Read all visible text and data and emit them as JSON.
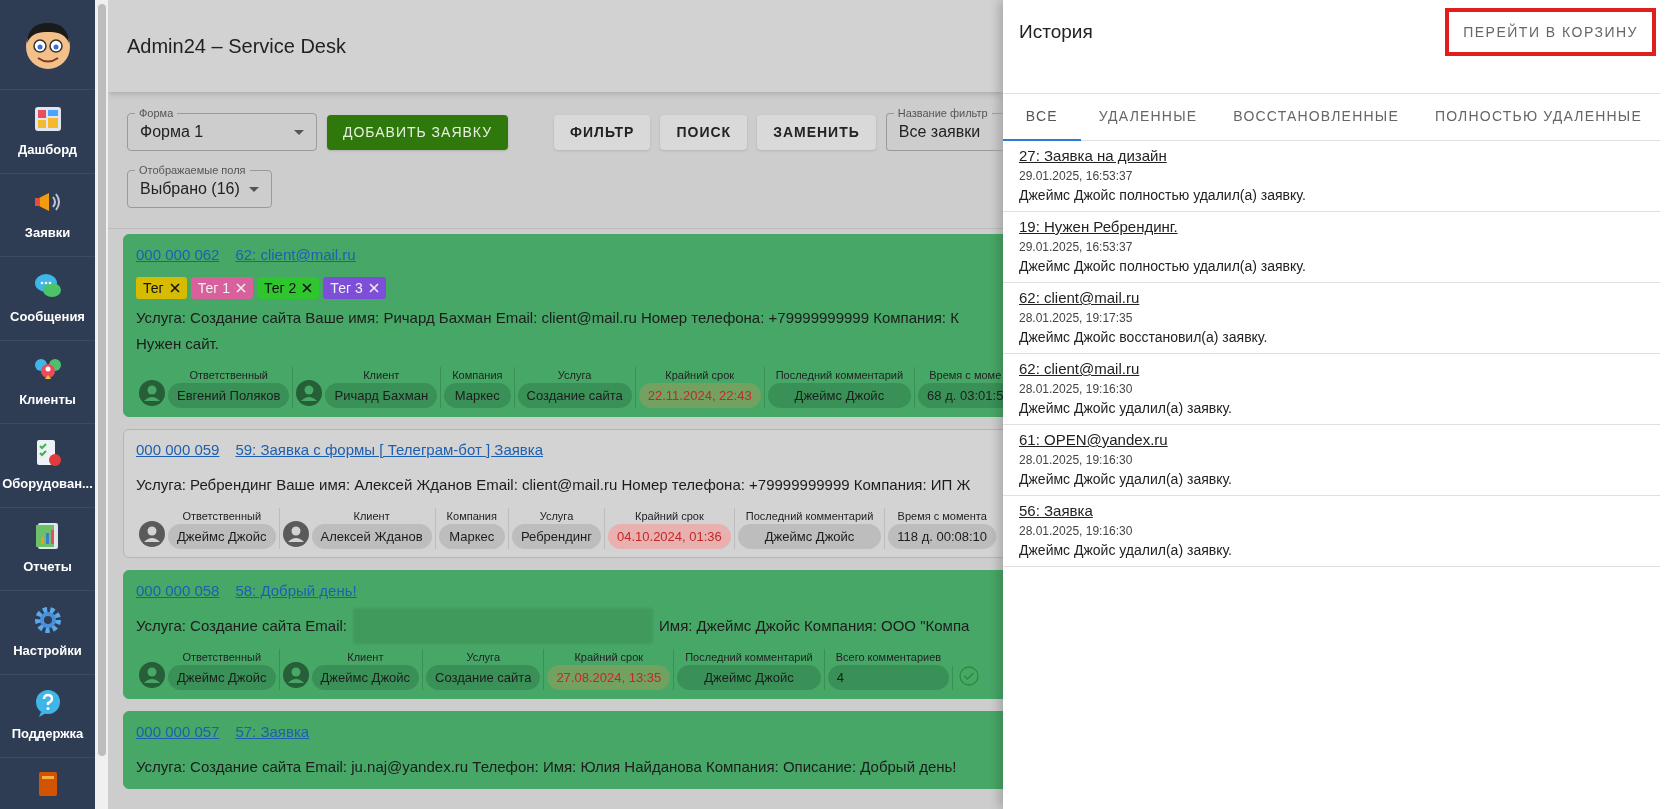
{
  "sidebar": {
    "items": [
      {
        "label": "Дашборд"
      },
      {
        "label": "Заявки"
      },
      {
        "label": "Сообщения"
      },
      {
        "label": "Клиенты"
      },
      {
        "label": "Оборудован..."
      },
      {
        "label": "Отчеты"
      },
      {
        "label": "Настройки"
      },
      {
        "label": "Поддержка"
      }
    ]
  },
  "header": {
    "title": "Admin24 – Service Desk"
  },
  "toolbar": {
    "form_select": {
      "label": "Форма",
      "value": "Форма 1"
    },
    "add_button": "ДОБАВИТЬ ЗАЯВКУ",
    "buttons": [
      "ФИЛЬТР",
      "ПОИСК",
      "ЗАМЕНИТЬ"
    ],
    "filter_select": {
      "label": "Название фильтр",
      "value": "Все заявки"
    },
    "fields_select": {
      "label": "Отображаемые поля",
      "value": "Выбрано (16)"
    }
  },
  "tickets": [
    {
      "number": "000 000 062",
      "title": "62: client@mail.ru",
      "highlighted": true,
      "checked": false,
      "tags": [
        {
          "label": "Тег",
          "color": "#d6bb00"
        },
        {
          "label": "Тег 1",
          "color": "#d8609c"
        },
        {
          "label": "Тег 2",
          "color": "#2fc52f"
        },
        {
          "label": "Тег 3",
          "color": "#7d4fd8"
        }
      ],
      "description": [
        {
          "text": "Услуга: Создание сайта Ваше имя: Ричард Бахман Email: client@mail.ru Номер телефона: +79999999999 Компания: К"
        },
        {
          "text": "Нужен сайт."
        }
      ],
      "fields": [
        {
          "kind": "person",
          "label": "Ответственный",
          "value": "Евгений Поляков"
        },
        {
          "kind": "person",
          "label": "Клиент",
          "value": "Ричард Бахман"
        },
        {
          "kind": "plain",
          "label": "Компания",
          "value": "Маркес"
        },
        {
          "kind": "plain",
          "label": "Услуга",
          "value": "Создание сайта"
        },
        {
          "kind": "deadline",
          "label": "Крайний срок",
          "value": "22.11.2024, 22:43"
        },
        {
          "kind": "plain",
          "label": "Последний комментарий",
          "value": "Джеймс Джойс"
        },
        {
          "kind": "plain",
          "label": "Время с моме",
          "value": "68 д. 03:01:5"
        }
      ]
    },
    {
      "number": "000 000 059",
      "title": "59: Заявка с формы [ Телеграм-бот ] Заявка",
      "highlighted": false,
      "checked": false,
      "description": [
        {
          "text": "Услуга: Ребрендинг Ваше имя: Алексей Жданов Email: client@mail.ru Номер телефона: +79999999999 Компания: ИП Ж"
        }
      ],
      "fields": [
        {
          "kind": "person",
          "label": "Ответственный",
          "value": "Джеймс Джойс"
        },
        {
          "kind": "person",
          "label": "Клиент",
          "value": "Алексей Жданов"
        },
        {
          "kind": "plain",
          "label": "Компания",
          "value": "Маркес"
        },
        {
          "kind": "plain",
          "label": "Услуга",
          "value": "Ребрендинг"
        },
        {
          "kind": "deadline",
          "label": "Крайний срок",
          "value": "04.10.2024, 01:36"
        },
        {
          "kind": "plain",
          "label": "Последний комментарий",
          "value": "Джеймс Джойс"
        },
        {
          "kind": "plain",
          "label": "Время с момента",
          "value": "118 д. 00:08:10"
        }
      ]
    },
    {
      "number": "000 000 058",
      "title": "58: Добрый день!",
      "highlighted": true,
      "checked": true,
      "description": [
        {
          "text": "Услуга: Создание сайта Email:",
          "redacted_after": true,
          "after": "Имя: Джеймс Джойс Компания: ООО \"Компа"
        }
      ],
      "fields": [
        {
          "kind": "person",
          "label": "Ответственный",
          "value": "Джеймс Джойс"
        },
        {
          "kind": "person",
          "label": "Клиент",
          "value": "Джеймс Джойс"
        },
        {
          "kind": "plain",
          "label": "Услуга",
          "value": "Создание сайта"
        },
        {
          "kind": "deadline",
          "label": "Крайний срок",
          "value": "27.08.2024, 13:35"
        },
        {
          "kind": "plain",
          "label": "Последний комментарий",
          "value": "Джеймс Джойс"
        },
        {
          "kind": "wide",
          "label": "Всего комментариев",
          "value": "4"
        }
      ]
    },
    {
      "number": "000 000 057",
      "title": "57: Заявка",
      "highlighted": true,
      "checked": false,
      "description": [
        {
          "text": "Услуга: Создание сайта Email: ju.naj@yandex.ru Телефон: Имя: Юлия Найданова Компания: Описание: Добрый день!"
        }
      ]
    }
  ],
  "history": {
    "title": "История",
    "trash_button": {
      "label": "ПЕРЕЙТИ В КОРЗИНУ",
      "highlighted": true
    },
    "tabs": [
      {
        "label": "ВСЕ",
        "selected": true
      },
      {
        "label": "УДАЛЕННЫЕ",
        "selected": false
      },
      {
        "label": "ВОССТАНОВЛЕННЫЕ",
        "selected": false
      },
      {
        "label": "ПОЛНОСТЬЮ УДАЛЕННЫЕ",
        "selected": false
      }
    ],
    "entries": [
      {
        "title": "27: Заявка на дизайн",
        "date": "29.01.2025, 16:53:37",
        "text": "Джеймс Джойс полностью удалил(а) заявку."
      },
      {
        "title": "19: Нужен Ребрендинг.",
        "date": "29.01.2025, 16:53:37",
        "text": "Джеймс Джойс полностью удалил(а) заявку."
      },
      {
        "title": "62: client@mail.ru",
        "date": "28.01.2025, 19:17:35",
        "text": "Джеймс Джойс восстановил(а) заявку."
      },
      {
        "title": "62: client@mail.ru",
        "date": "28.01.2025, 19:16:30",
        "text": "Джеймс Джойс удалил(а) заявку."
      },
      {
        "title": "61: OPEN@yandex.ru",
        "date": "28.01.2025, 19:16:30",
        "text": "Джеймс Джойс удалил(а) заявку."
      },
      {
        "title": "56: Заявка",
        "date": "28.01.2025, 19:16:30",
        "text": "Джеймс Джойс удалил(а) заявку."
      }
    ]
  }
}
